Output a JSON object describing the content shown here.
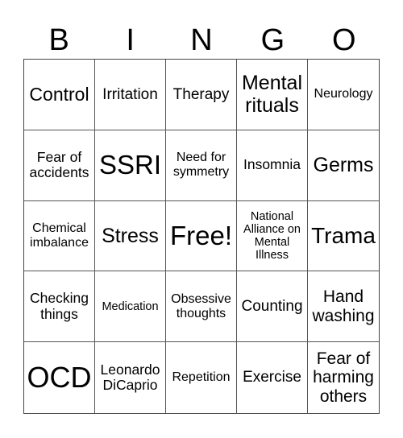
{
  "header": [
    "B",
    "I",
    "N",
    "G",
    "O"
  ],
  "cells": [
    "Control",
    "Irritation",
    "Therapy",
    "Mental rituals",
    "Neurology",
    "Fear of accidents",
    "SSRI",
    "Need for symmetry",
    "Insomnia",
    "Germs",
    "Chemical imbalance",
    "Stress",
    "Free!",
    "National Alliance on Mental Illness",
    "Trama",
    "Checking things",
    "Medication",
    "Obsessive thoughts",
    "Counting",
    "Hand washing",
    "OCD",
    "Leonardo DiCaprio",
    "Repetition",
    "Exercise",
    "Fear of harming others"
  ]
}
